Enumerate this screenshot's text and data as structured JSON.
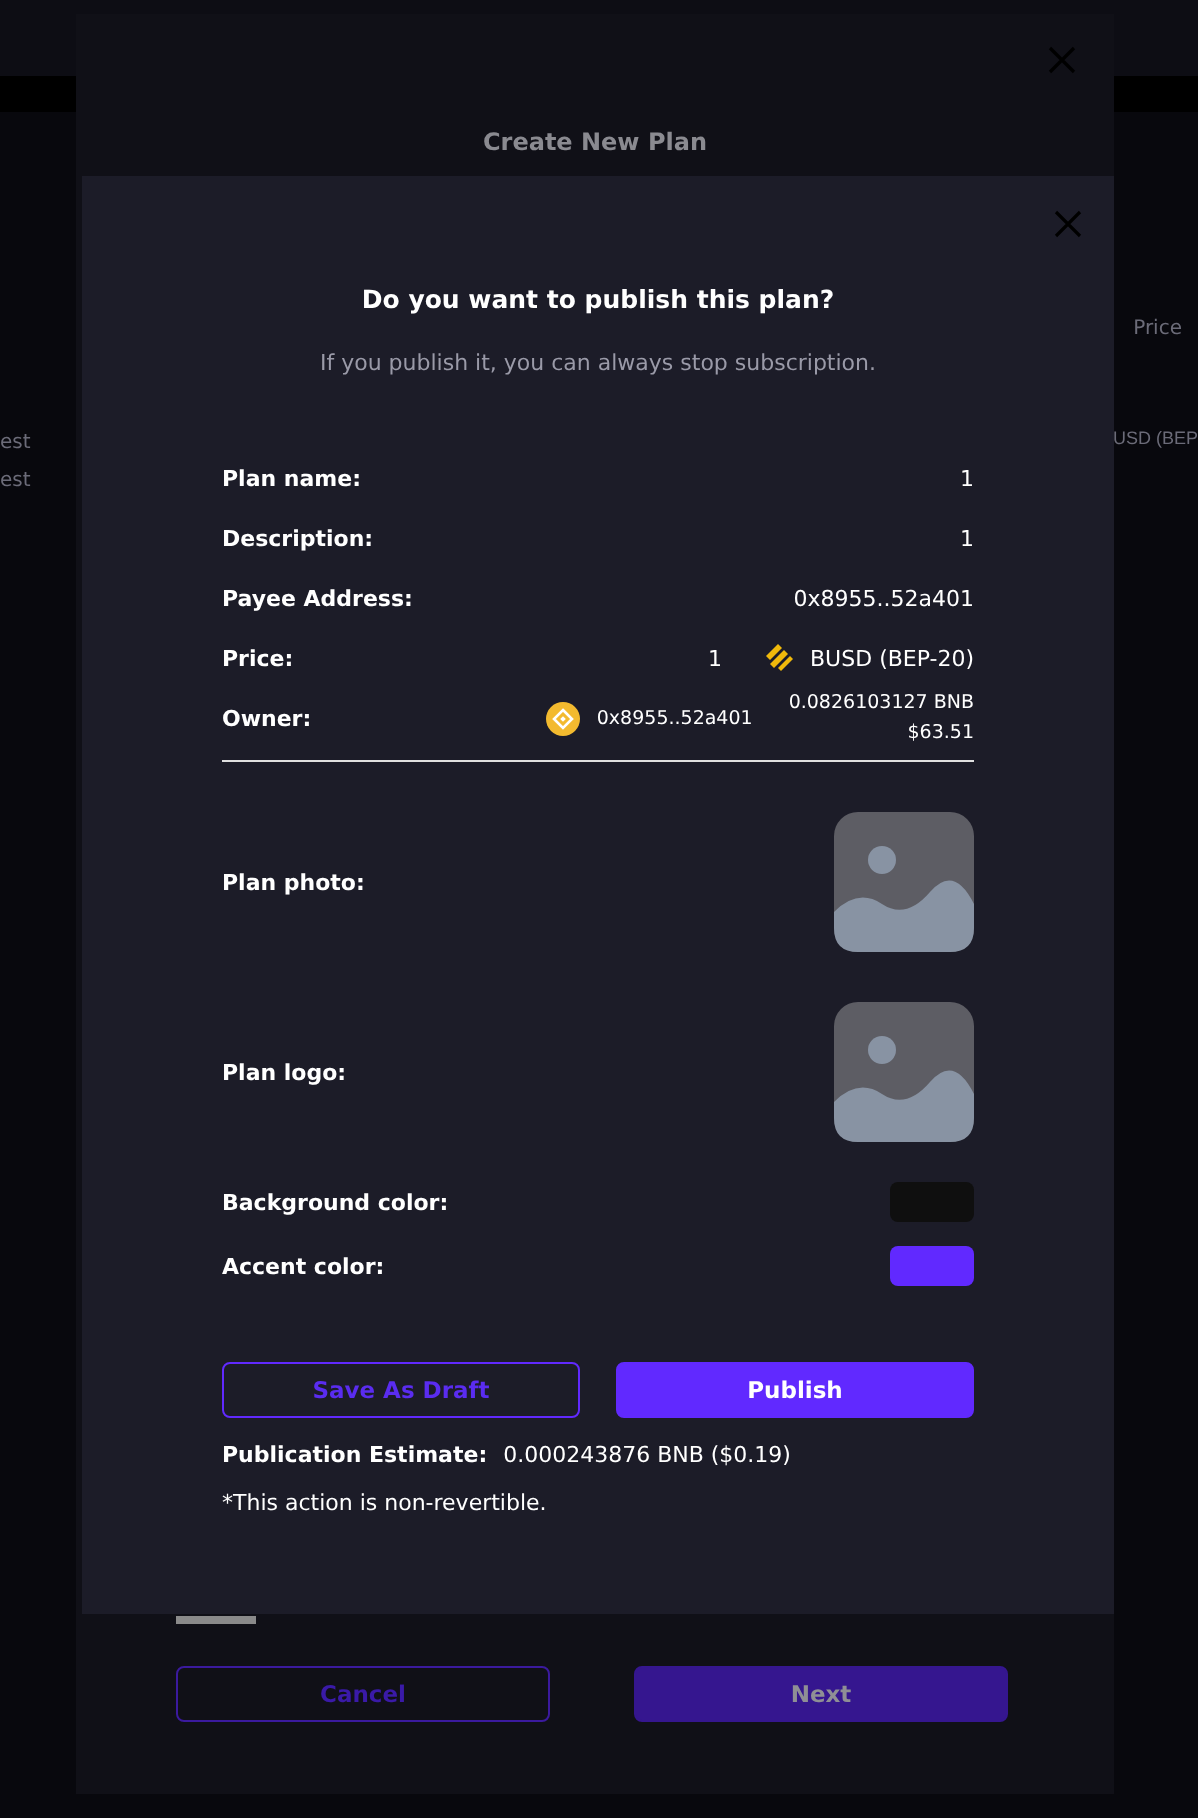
{
  "background": {
    "left_cells": [
      "est",
      "est"
    ],
    "column_header": "Price",
    "price_cell": "USD (BEP"
  },
  "create_modal": {
    "title": "Create New Plan",
    "buttons": [
      {
        "label": "Cancel",
        "kind": "outline"
      },
      {
        "label": "Next",
        "kind": "filled"
      }
    ]
  },
  "publish_modal": {
    "title": "Do you want to publish this plan?",
    "subtitle": "If you publish it, you can always stop subscription.",
    "details": [
      {
        "kind": "text",
        "label": "Plan name:",
        "value": "1"
      },
      {
        "kind": "text",
        "label": "Description:",
        "value": "1"
      },
      {
        "kind": "text",
        "label": "Payee Address:",
        "value": "0x8955..52a401"
      },
      {
        "kind": "price",
        "label": "Price:",
        "amount": "1",
        "token": "BUSD (BEP-20)"
      },
      {
        "kind": "owner",
        "label": "Owner:",
        "address": "0x8955..52a401",
        "balance": "0.0826103127 BNB",
        "usd": "$63.51"
      }
    ],
    "images": [
      {
        "label": "Plan photo:"
      },
      {
        "label": "Plan logo:"
      }
    ],
    "colors": [
      {
        "label": "Background color:",
        "color": "#0f0f0f"
      },
      {
        "label": "Accent color:",
        "color": "#6129ff"
      }
    ],
    "buttons": [
      {
        "label": "Save As Draft",
        "kind": "outline"
      },
      {
        "label": "Publish",
        "kind": "filled"
      }
    ],
    "estimate_label": "Publication Estimate:",
    "estimate_value": "0.000243876 BNB ($0.19)",
    "note": "*This action is non-revertible."
  }
}
